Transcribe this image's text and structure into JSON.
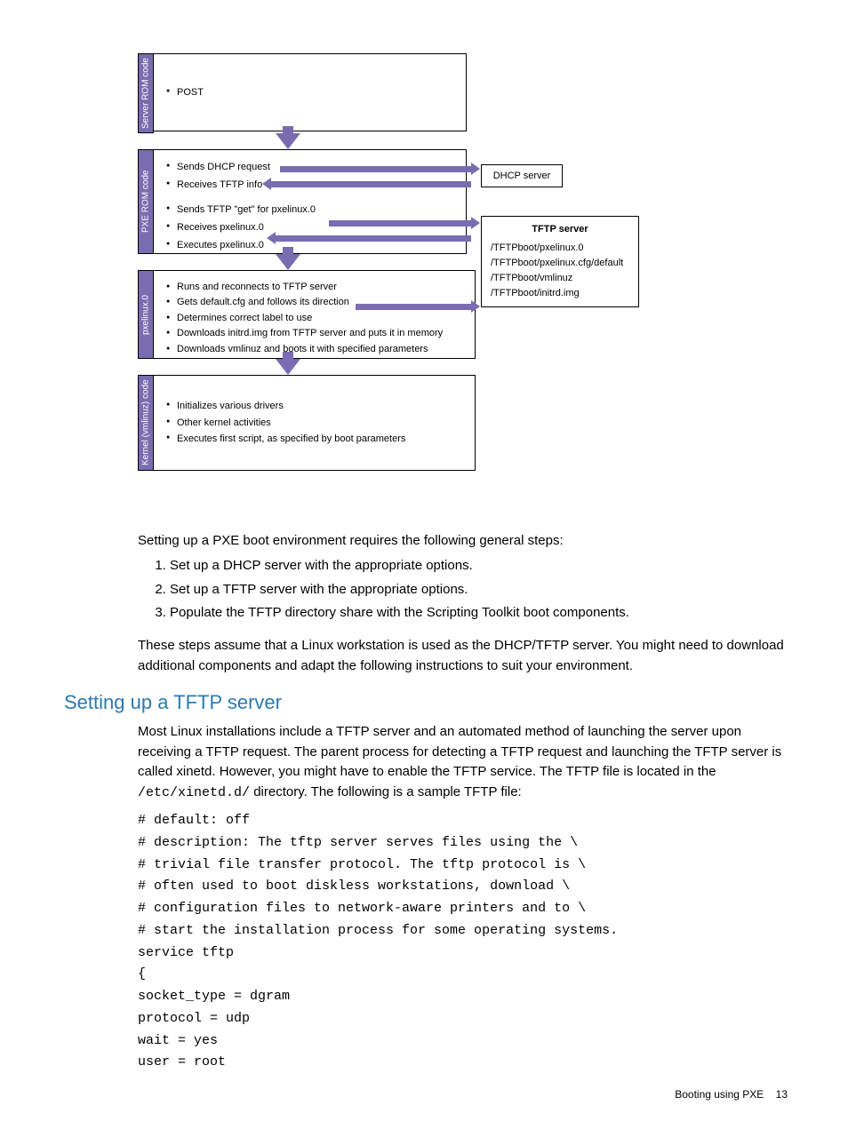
{
  "diagram": {
    "phase1": {
      "label": "Server ROM code",
      "items": [
        "POST"
      ]
    },
    "phase2": {
      "label": "PXE ROM code",
      "items": [
        "Sends DHCP request",
        "Receives TFTP info",
        "Sends TFTP \"get\" for pxelinux.0",
        "Receives pxelinux.0",
        "Executes pxelinux.0"
      ]
    },
    "phase3": {
      "label": "pxelinux.0",
      "items": [
        "Runs and reconnects to TFTP server",
        "Gets default.cfg and follows its direction",
        "Determines correct label to use",
        "Downloads initrd.img from TFTP server and puts it in memory",
        "Downloads vmlinuz and boots it with specified parameters"
      ]
    },
    "phase4": {
      "label": "Kernel (vmlinuz) code",
      "items": [
        "Initializes various drivers",
        "Other kernel activities",
        "Executes first script, as specified by boot parameters"
      ]
    },
    "dhcp_server": "DHCP server",
    "tftp_server": {
      "title": "TFTP server",
      "lines": [
        "/TFTPboot/pxelinux.0",
        "/TFTPboot/pxelinux.cfg/default",
        "/TFTPboot/vmlinuz",
        "/TFTPboot/initrd.img"
      ]
    }
  },
  "body": {
    "intro": "Setting up a PXE boot environment requires the following general steps:",
    "steps": [
      "Set up a DHCP server with the appropriate options.",
      "Set up a TFTP server with the appropriate options.",
      "Populate the TFTP directory share with the Scripting Toolkit boot components."
    ],
    "note": "These steps assume that a Linux workstation is used as the DHCP/TFTP server. You might need to download additional components and adapt the following instructions to suit your environment."
  },
  "section": {
    "title": "Setting up a TFTP server",
    "para_pre": "Most Linux installations include a TFTP server and an automated method of launching the server upon receiving a TFTP request. The parent process for detecting a TFTP request and launching the TFTP server is called xinetd. However, you might have to enable the TFTP service. The TFTP file is located in the ",
    "para_code": "/etc/xinetd.d/",
    "para_post": " directory. The following is a sample TFTP file:",
    "code": "# default: off\n# description: The tftp server serves files using the \\\n# trivial file transfer protocol. The tftp protocol is \\\n# often used to boot diskless workstations, download \\\n# configuration files to network-aware printers and to \\\n# start the installation process for some operating systems.\nservice tftp\n{\nsocket_type = dgram\nprotocol = udp\nwait = yes\nuser = root"
  },
  "footer": {
    "text": "Booting using PXE",
    "page": "13"
  }
}
